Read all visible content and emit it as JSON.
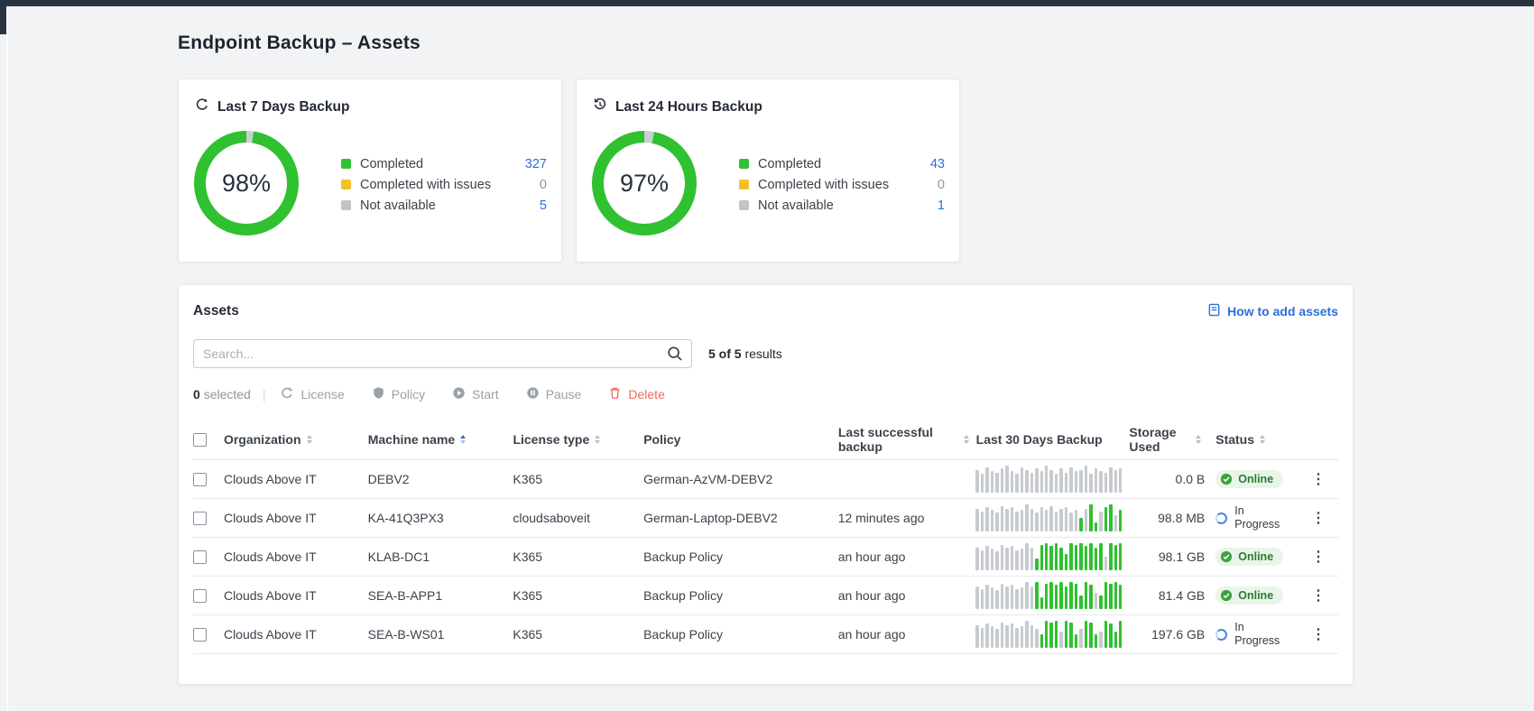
{
  "page": {
    "title": "Endpoint Backup – Assets"
  },
  "icons": {
    "kebab": "⋮"
  },
  "cards": [
    {
      "title": "Last 7 Days Backup",
      "icon": "sync-icon",
      "percent": "98%",
      "ring": {
        "color": "#2fc12f",
        "gap_color": "#c9ced2",
        "gap_deg": 8
      },
      "legend": [
        {
          "label": "Completed",
          "swatch": "#2fc12f",
          "value": "327",
          "value_style": "link"
        },
        {
          "label": "Completed with issues",
          "swatch": "#f5c026",
          "value": "0",
          "value_style": "muted"
        },
        {
          "label": "Not available",
          "swatch": "#bfc5ca",
          "value": "5",
          "value_style": "link"
        }
      ]
    },
    {
      "title": "Last 24 Hours Backup",
      "icon": "history-icon",
      "percent": "97%",
      "ring": {
        "color": "#2fc12f",
        "gap_color": "#c9ced2",
        "gap_deg": 11
      },
      "legend": [
        {
          "label": "Completed",
          "swatch": "#2fc12f",
          "value": "43",
          "value_style": "link"
        },
        {
          "label": "Completed with issues",
          "swatch": "#f5c026",
          "value": "0",
          "value_style": "muted"
        },
        {
          "label": "Not available",
          "swatch": "#bfc5ca",
          "value": "1",
          "value_style": "link"
        }
      ]
    }
  ],
  "chart_data": [
    {
      "type": "pie",
      "title": "Last 7 Days Backup",
      "categories": [
        "Completed",
        "Completed with issues",
        "Not available"
      ],
      "values": [
        327,
        0,
        5
      ],
      "center_label": "98%",
      "colors": [
        "#2fc12f",
        "#f5c026",
        "#bfc5ca"
      ],
      "legend_position": "right"
    },
    {
      "type": "pie",
      "title": "Last 24 Hours Backup",
      "categories": [
        "Completed",
        "Completed with issues",
        "Not available"
      ],
      "values": [
        43,
        0,
        1
      ],
      "center_label": "97%",
      "colors": [
        "#2fc12f",
        "#f5c026",
        "#bfc5ca"
      ],
      "legend_position": "right"
    }
  ],
  "assets": {
    "title": "Assets",
    "help_link": {
      "label": "How to add assets",
      "icon": "book-icon"
    },
    "search": {
      "placeholder": "Search...",
      "icon": "search-icon"
    },
    "results": {
      "bold": "5 of 5",
      "rest": "results"
    },
    "toolbar": {
      "selected_count": "0",
      "selected_label": "selected",
      "divider": "|",
      "buttons": [
        {
          "label": "License",
          "icon": "license-icon",
          "variant": "disabled"
        },
        {
          "label": "Policy",
          "icon": "policy-icon",
          "variant": "disabled"
        },
        {
          "label": "Start",
          "icon": "start-icon",
          "variant": "disabled"
        },
        {
          "label": "Pause",
          "icon": "pause-icon",
          "variant": "disabled"
        },
        {
          "label": "Delete",
          "icon": "delete-icon",
          "variant": "danger"
        }
      ]
    },
    "table": {
      "columns": [
        {
          "label": "Organization",
          "sort": "both"
        },
        {
          "label": "Machine name",
          "sort": "asc"
        },
        {
          "label": "License type",
          "sort": "both"
        },
        {
          "label": "Policy",
          "sort": "none"
        },
        {
          "label": "Last successful backup",
          "sort": "both"
        },
        {
          "label": "Last 30 Days Backup",
          "sort": "none"
        },
        {
          "label": "Storage Used",
          "sort": "both"
        },
        {
          "label": "Status",
          "sort": "both"
        }
      ],
      "rows": [
        {
          "organization": "Clouds Above IT",
          "machine_name": "DEBV2",
          "license_type": "K365",
          "policy": "German-AzVM-DEBV2",
          "last_successful_backup": "",
          "storage_used": "0.0 B",
          "status": "Online",
          "status_variant": "online",
          "bars": "g85 g70 g95 g80 g75 g90 g100 g80 g70 g95 g85 g75 g90 g80 g100 g85 g70 g90 g75 g95 g80 g85 g100 g70 g90 g80 g75 g95 g85 g90"
        },
        {
          "organization": "Clouds Above IT",
          "machine_name": "KA-41Q3PX3",
          "license_type": "cloudsaboveit",
          "policy": "German-Laptop-DEBV2",
          "last_successful_backup": "12 minutes ago",
          "storage_used": "98.8 MB",
          "status": "In Progress",
          "status_variant": "in-progress",
          "bars": "g85 g75 g90 g80 g70 g95 g85 g90 g75 g80 g100 g85 g70 g90 g80 g95 g75 g85 g90 g70 g80 G50 g85 G100 G35 g75 G90 G100 g60 G80"
        },
        {
          "organization": "Clouds Above IT",
          "machine_name": "KLAB-DC1",
          "license_type": "K365",
          "policy": "Backup Policy",
          "last_successful_backup": "an hour ago",
          "storage_used": "98.1 GB",
          "status": "Online",
          "status_variant": "online",
          "bars": "g85 g75 g90 g80 g70 g95 g85 g90 g75 g80 g100 g85 G45 G95 G100 G90 G100 G85 G60 G100 G95 G100 G90 G100 G85 G100 g50 G100 G95 G100"
        },
        {
          "organization": "Clouds Above IT",
          "machine_name": "SEA-B-APP1",
          "license_type": "K365",
          "policy": "Backup Policy",
          "last_successful_backup": "an hour ago",
          "storage_used": "81.4 GB",
          "status": "Online",
          "status_variant": "online",
          "bars": "g85 g75 g90 g80 g70 g95 g85 g90 g75 g80 g100 g85 G100 G45 G95 G100 G90 G100 G85 G100 G95 G50 G100 G90 g60 G50 G100 G95 G100 G90"
        },
        {
          "organization": "Clouds Above IT",
          "machine_name": "SEA-B-WS01",
          "license_type": "K365",
          "policy": "Backup Policy",
          "last_successful_backup": "an hour ago",
          "storage_used": "197.6 GB",
          "status": "In Progress",
          "status_variant": "in-progress",
          "bars": "g85 g75 g90 g80 g70 g95 g85 g90 g75 g80 g100 g85 g70 G50 G100 G95 G100 g60 G100 G95 G50 g70 G100 G95 G50 g60 G100 G90 G60 G100"
        }
      ]
    }
  },
  "colors": {
    "accent_frame": "#273341",
    "link_blue": "#2a6fdb",
    "bar_gray": "#c7cbd0",
    "bar_green": "#2fc12f",
    "online_pill_bg": "#e9f5e9",
    "online_text": "#2c7c31",
    "danger": "#f0685e"
  }
}
